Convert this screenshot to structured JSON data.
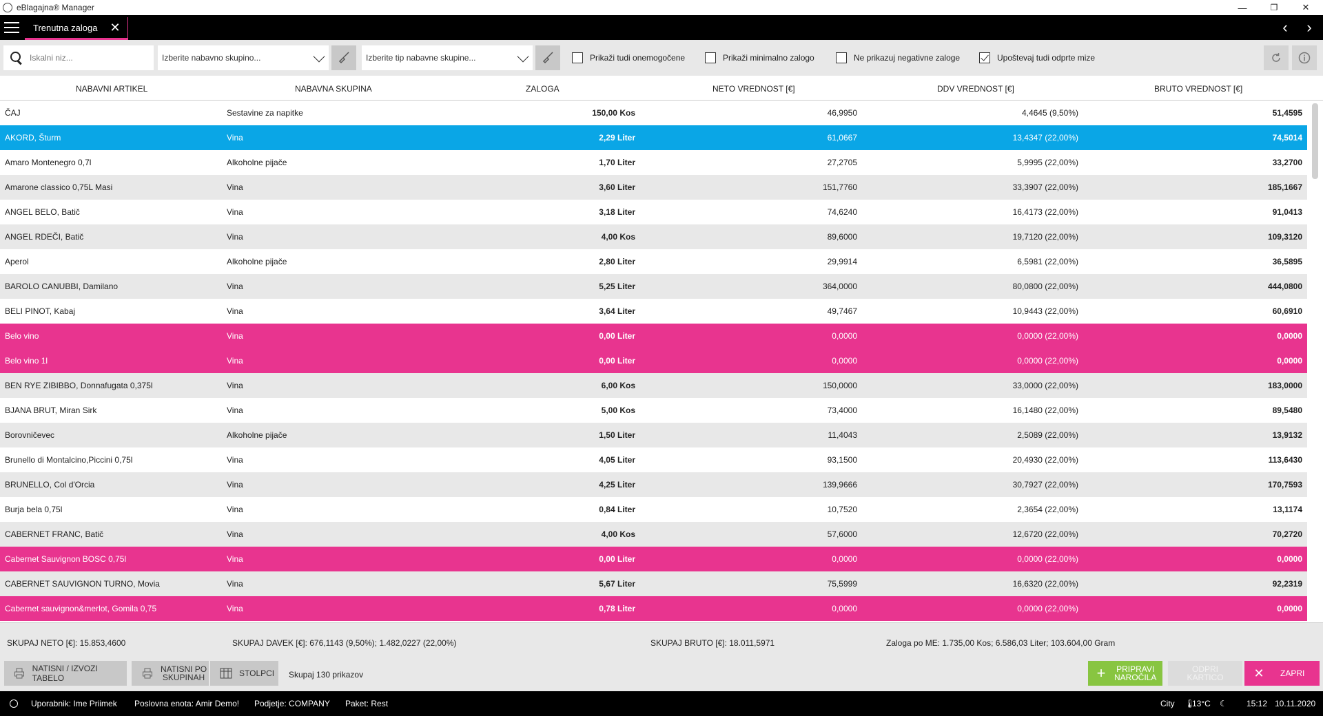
{
  "window": {
    "title": "eBlagajna® Manager",
    "controls": [
      "—",
      "❐",
      "✕"
    ]
  },
  "tabbar": {
    "tab_label": "Trenutna zaloga",
    "tab_close": "✕",
    "nav_prev": "‹",
    "nav_next": "›"
  },
  "toolbar": {
    "search_placeholder": "Iskalni niz...",
    "group_dropdown": "Izberite nabavno skupino...",
    "type_dropdown": "Izberite tip nabavne skupine...",
    "checkboxes": [
      {
        "label": "Prikaži tudi onemogočene",
        "checked": false
      },
      {
        "label": "Prikaži minimalno zalogo",
        "checked": false
      },
      {
        "label": "Ne prikazuj negativne zaloge",
        "checked": false
      },
      {
        "label": "Upoštevaj tudi odprte mize",
        "checked": true
      }
    ]
  },
  "table": {
    "headers": [
      "NABAVNI ARTIKEL",
      "NABAVNA SKUPINA",
      "ZALOGA",
      "NETO VREDNOST [€]",
      "DDV VREDNOST [€]",
      "BRUTO VREDNOST [€]"
    ],
    "rows": [
      {
        "artikel": "ČAJ",
        "skupina": "Sestavine za napitke",
        "zaloga": "150,00 Kos",
        "neto": "46,9950",
        "ddv": "4,4645 (9,50%)",
        "bruto": "51,4595",
        "state": "normal"
      },
      {
        "artikel": "AKORD, Šturm",
        "skupina": "Vina",
        "zaloga": "2,29 Liter",
        "neto": "61,0667",
        "ddv": "13,4347 (22,00%)",
        "bruto": "74,5014",
        "state": "selected"
      },
      {
        "artikel": "Amaro Montenegro 0,7l",
        "skupina": "Alkoholne pijače",
        "zaloga": "1,70 Liter",
        "neto": "27,2705",
        "ddv": "5,9995 (22,00%)",
        "bruto": "33,2700",
        "state": "normal"
      },
      {
        "artikel": "Amarone classico 0,75L Masi",
        "skupina": "Vina",
        "zaloga": "3,60 Liter",
        "neto": "151,7760",
        "ddv": "33,3907 (22,00%)",
        "bruto": "185,1667",
        "state": "alt"
      },
      {
        "artikel": "ANGEL BELO, Batič",
        "skupina": "Vina",
        "zaloga": "3,18 Liter",
        "neto": "74,6240",
        "ddv": "16,4173 (22,00%)",
        "bruto": "91,0413",
        "state": "normal"
      },
      {
        "artikel": "ANGEL RDEČI, Batič",
        "skupina": "Vina",
        "zaloga": "4,00 Kos",
        "neto": "89,6000",
        "ddv": "19,7120 (22,00%)",
        "bruto": "109,3120",
        "state": "alt"
      },
      {
        "artikel": "Aperol",
        "skupina": "Alkoholne pijače",
        "zaloga": "2,80 Liter",
        "neto": "29,9914",
        "ddv": "6,5981 (22,00%)",
        "bruto": "36,5895",
        "state": "normal"
      },
      {
        "artikel": "BAROLO CANUBBI, Damilano",
        "skupina": "Vina",
        "zaloga": "5,25 Liter",
        "neto": "364,0000",
        "ddv": "80,0800 (22,00%)",
        "bruto": "444,0800",
        "state": "alt"
      },
      {
        "artikel": "BELI PINOT, Kabaj",
        "skupina": "Vina",
        "zaloga": "3,64 Liter",
        "neto": "49,7467",
        "ddv": "10,9443 (22,00%)",
        "bruto": "60,6910",
        "state": "normal"
      },
      {
        "artikel": "Belo vino",
        "skupina": "Vina",
        "zaloga": "0,00 Liter",
        "neto": "0,0000",
        "ddv": "0,0000 (22,00%)",
        "bruto": "0,0000",
        "state": "zero"
      },
      {
        "artikel": "Belo vino 1l",
        "skupina": "Vina",
        "zaloga": "0,00 Liter",
        "neto": "0,0000",
        "ddv": "0,0000 (22,00%)",
        "bruto": "0,0000",
        "state": "zero"
      },
      {
        "artikel": "BEN RYE ZIBIBBO, Donnafugata 0,375l",
        "skupina": "Vina",
        "zaloga": "6,00 Kos",
        "neto": "150,0000",
        "ddv": "33,0000 (22,00%)",
        "bruto": "183,0000",
        "state": "alt"
      },
      {
        "artikel": "BJANA BRUT, Miran Sirk",
        "skupina": "Vina",
        "zaloga": "5,00 Kos",
        "neto": "73,4000",
        "ddv": "16,1480 (22,00%)",
        "bruto": "89,5480",
        "state": "normal"
      },
      {
        "artikel": "Borovničevec",
        "skupina": "Alkoholne pijače",
        "zaloga": "1,50 Liter",
        "neto": "11,4043",
        "ddv": "2,5089 (22,00%)",
        "bruto": "13,9132",
        "state": "alt"
      },
      {
        "artikel": "Brunello di Montalcino,Piccini 0,75l",
        "skupina": "Vina",
        "zaloga": "4,05 Liter",
        "neto": "93,1500",
        "ddv": "20,4930 (22,00%)",
        "bruto": "113,6430",
        "state": "normal"
      },
      {
        "artikel": "BRUNELLO, Col d'Orcia",
        "skupina": "Vina",
        "zaloga": "4,25 Liter",
        "neto": "139,9666",
        "ddv": "30,7927 (22,00%)",
        "bruto": "170,7593",
        "state": "alt"
      },
      {
        "artikel": "Burja bela 0,75l",
        "skupina": "Vina",
        "zaloga": "0,84 Liter",
        "neto": "10,7520",
        "ddv": "2,3654 (22,00%)",
        "bruto": "13,1174",
        "state": "normal"
      },
      {
        "artikel": "CABERNET FRANC, Batič",
        "skupina": "Vina",
        "zaloga": "4,00 Kos",
        "neto": "57,6000",
        "ddv": "12,6720 (22,00%)",
        "bruto": "70,2720",
        "state": "alt"
      },
      {
        "artikel": "Cabernet Sauvignon BOSC 0,75l",
        "skupina": "Vina",
        "zaloga": "0,00 Liter",
        "neto": "0,0000",
        "ddv": "0,0000 (22,00%)",
        "bruto": "0,0000",
        "state": "zero"
      },
      {
        "artikel": "CABERNET SAUVIGNON TURNO, Movia",
        "skupina": "Vina",
        "zaloga": "5,67 Liter",
        "neto": "75,5999",
        "ddv": "16,6320 (22,00%)",
        "bruto": "92,2319",
        "state": "alt"
      },
      {
        "artikel": "Cabernet sauvignon&merlot, Gomila 0,75",
        "skupina": "Vina",
        "zaloga": "0,78 Liter",
        "neto": "0,0000",
        "ddv": "0,0000 (22,00%)",
        "bruto": "0,0000",
        "state": "zero"
      }
    ]
  },
  "summary": {
    "neto": "SKUPAJ NETO [€]: 15.853,4600",
    "davek": "SKUPAJ DAVEK [€]: 676,1143 (9,50%); 1.482,0227 (22,00%)",
    "bruto": "SKUPAJ BRUTO [€]: 18.011,5971",
    "zaloga": "Zaloga po ME: 1.735,00 Kos; 6.586,03 Liter; 103.604,00 Gram"
  },
  "actions": {
    "print_export": "NATISNI / IZVOZI TABELO",
    "print_groups_1": "NATISNI PO",
    "print_groups_2": "SKUPINAH",
    "columns": "STOLPCI",
    "count": "Skupaj 130 prikazov",
    "prepare_orders_1": "PRIPRAVI",
    "prepare_orders_2": "NAROČILA",
    "open_card_1": "ODPRI",
    "open_card_2": "KARTICO",
    "close": "ZAPRI"
  },
  "statusbar": {
    "user": "Uporabnik: Ime Priimek",
    "unit": "Poslovna enota: Amir Demo!",
    "company": "Podjetje: COMPANY",
    "package": "Paket: Rest",
    "city": "City",
    "temp": "13°C",
    "time": "15:12",
    "date": "10.11.2020"
  },
  "colors": {
    "accent": "#e8348f",
    "selected": "#0aa6e6",
    "green": "#88c541"
  }
}
